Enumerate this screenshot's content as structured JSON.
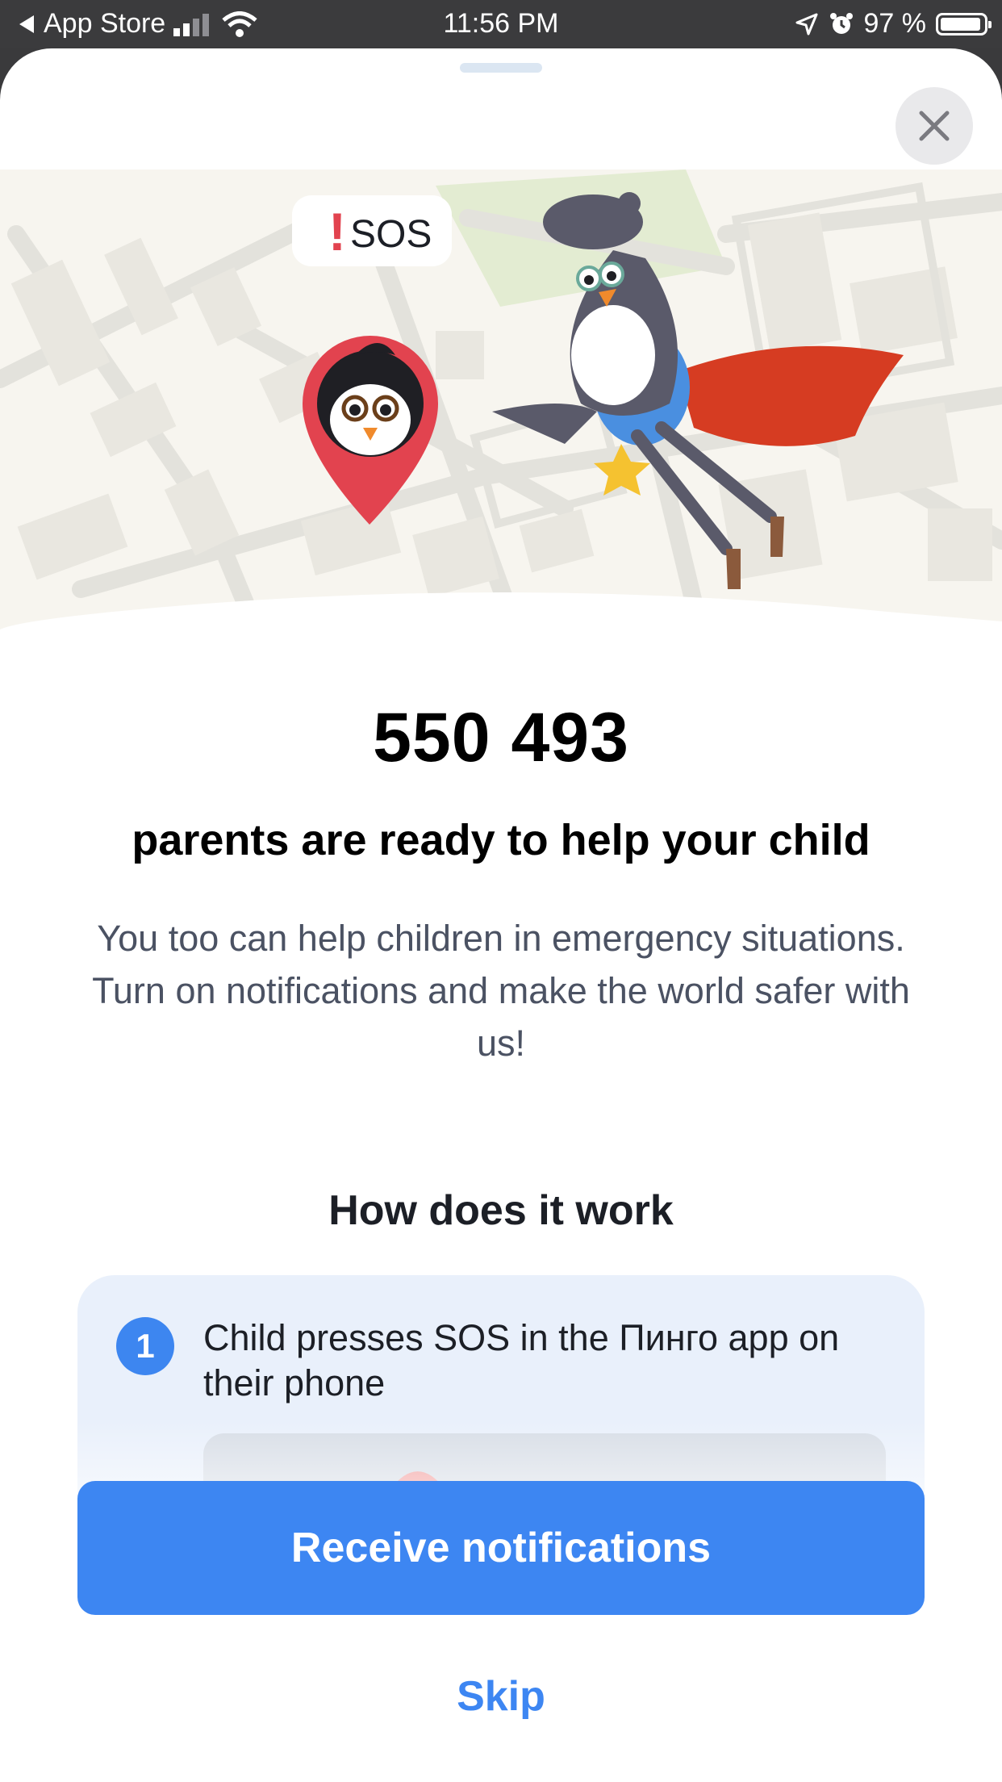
{
  "status_bar": {
    "back_label": "App Store",
    "time": "11:56 PM",
    "battery": "97 %"
  },
  "illustration": {
    "sos_label": "SOS",
    "exclamation": "!"
  },
  "headline": "550 493",
  "subhead": "parents are ready to help your child",
  "body": "You too can help children in emergency situations. Turn on notifications and make the world safer with us!",
  "how_title": "How does it work",
  "steps": [
    {
      "number": "1",
      "text": "Child presses SOS in the Пинго app on their phone"
    }
  ],
  "buttons": {
    "primary": "Receive notifications",
    "skip": "Skip"
  },
  "colors": {
    "accent": "#3d86f2",
    "sos_red": "#e2434f",
    "cape_red": "#d63c22",
    "card_bg": "#e9f0fb"
  }
}
